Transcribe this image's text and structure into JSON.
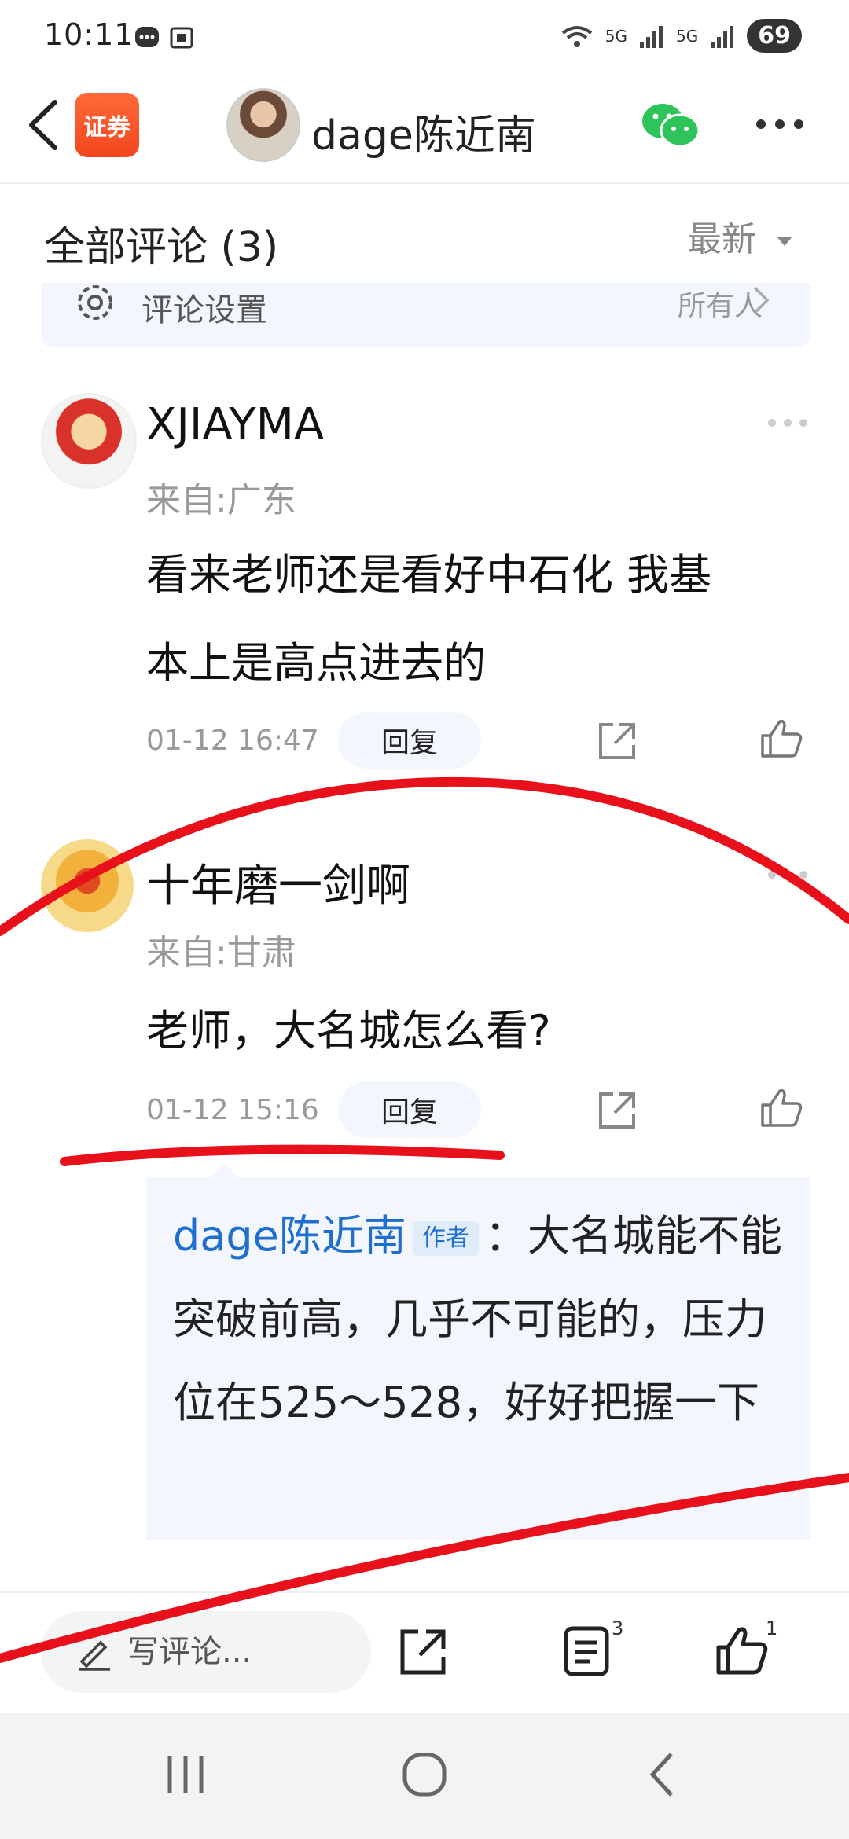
{
  "status_bar": {
    "time": "10:11",
    "network_label_1": "5G",
    "network_label_2": "5G",
    "battery": "69"
  },
  "header": {
    "app_badge": "证券",
    "author_name": "dage陈近南"
  },
  "comments_header": {
    "title": "全部评论 (3)",
    "sort": "最新"
  },
  "settings": {
    "label": "评论设置",
    "value": "所有人"
  },
  "comments": [
    {
      "user": "XJIAYMA",
      "location": "来自:广东",
      "text_line1": "看来老师还是看好中石化 我基",
      "text_line2": "本上是高点进去的",
      "time": "01-12 16:47",
      "reply_label": "回复"
    },
    {
      "user": "十年磨一剑啊",
      "location": "来自:甘肃",
      "text_line1": "老师，大名城怎么看?",
      "time": "01-12 15:16",
      "reply_label": "回复",
      "reply": {
        "author": "dage陈近南",
        "tag": "作者",
        "text": "：大名城能不能突破前高，几乎不可能的，压力位在525～528，好好把握一下"
      }
    }
  ],
  "bottom_bar": {
    "input_placeholder": "写评论...",
    "comment_count": "3",
    "like_count": "1"
  },
  "colors": {
    "accent_blue": "#1e6fd0",
    "app_orange": "#f2461e",
    "annotation_red": "#e8101a",
    "wechat_green": "#2fc45a"
  },
  "icons": [
    "back-arrow-icon",
    "wechat-icon",
    "more-icon",
    "gear-icon",
    "chevron-right-icon",
    "share-icon",
    "thumbs-up-icon",
    "pen-icon",
    "list-icon"
  ]
}
